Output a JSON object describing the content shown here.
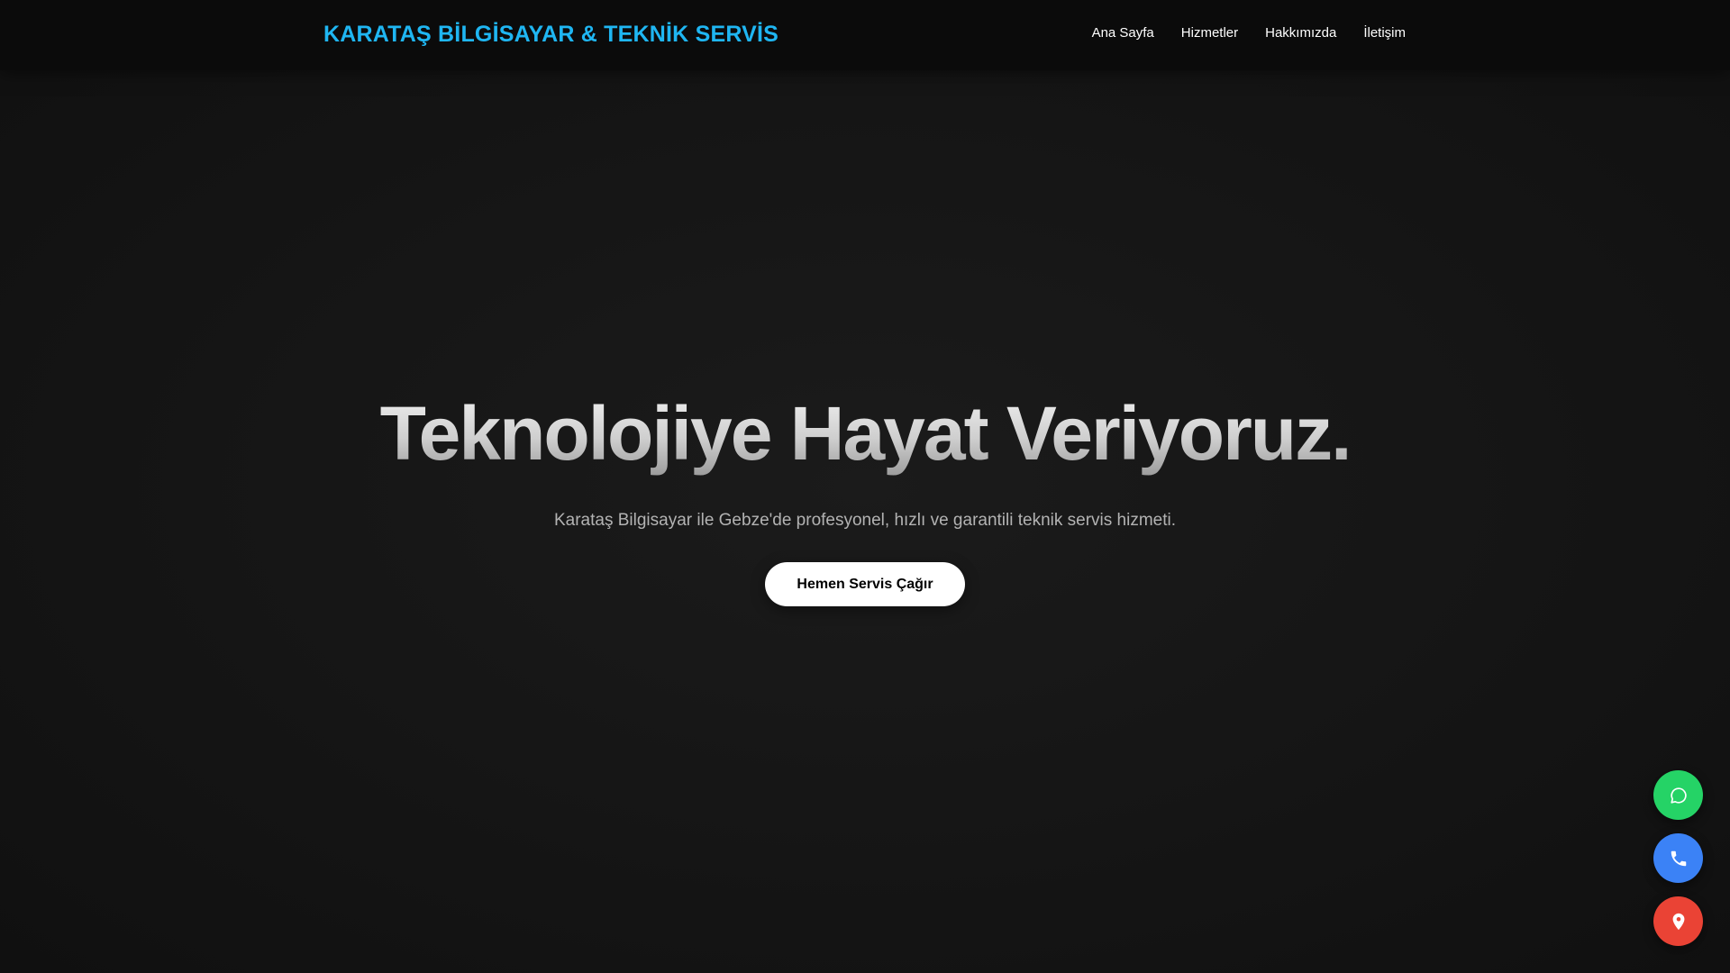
{
  "header": {
    "brand": "KARATAŞ BİLGİSAYAR & TEKNİK SERVİS",
    "nav": [
      {
        "label": "Ana Sayfa"
      },
      {
        "label": "Hizmetler"
      },
      {
        "label": "Hakkımızda"
      },
      {
        "label": "İletişim"
      }
    ]
  },
  "hero": {
    "title": "Teknolojiye Hayat Veriyoruz.",
    "subtitle": "Karataş Bilgisayar ile Gebze'de profesyonel, hızlı ve garantili teknik servis hizmeti.",
    "cta_label": "Hemen Servis Çağır"
  },
  "floating_actions": [
    {
      "icon": "whatsapp-icon",
      "color": "#25d366"
    },
    {
      "icon": "phone-icon",
      "color": "#3b82f6"
    },
    {
      "icon": "location-pin-icon",
      "color": "#ea4335"
    }
  ],
  "colors": {
    "brand": "#1fb6f2",
    "background": "#141414",
    "navbar": "#0b0b0b"
  }
}
